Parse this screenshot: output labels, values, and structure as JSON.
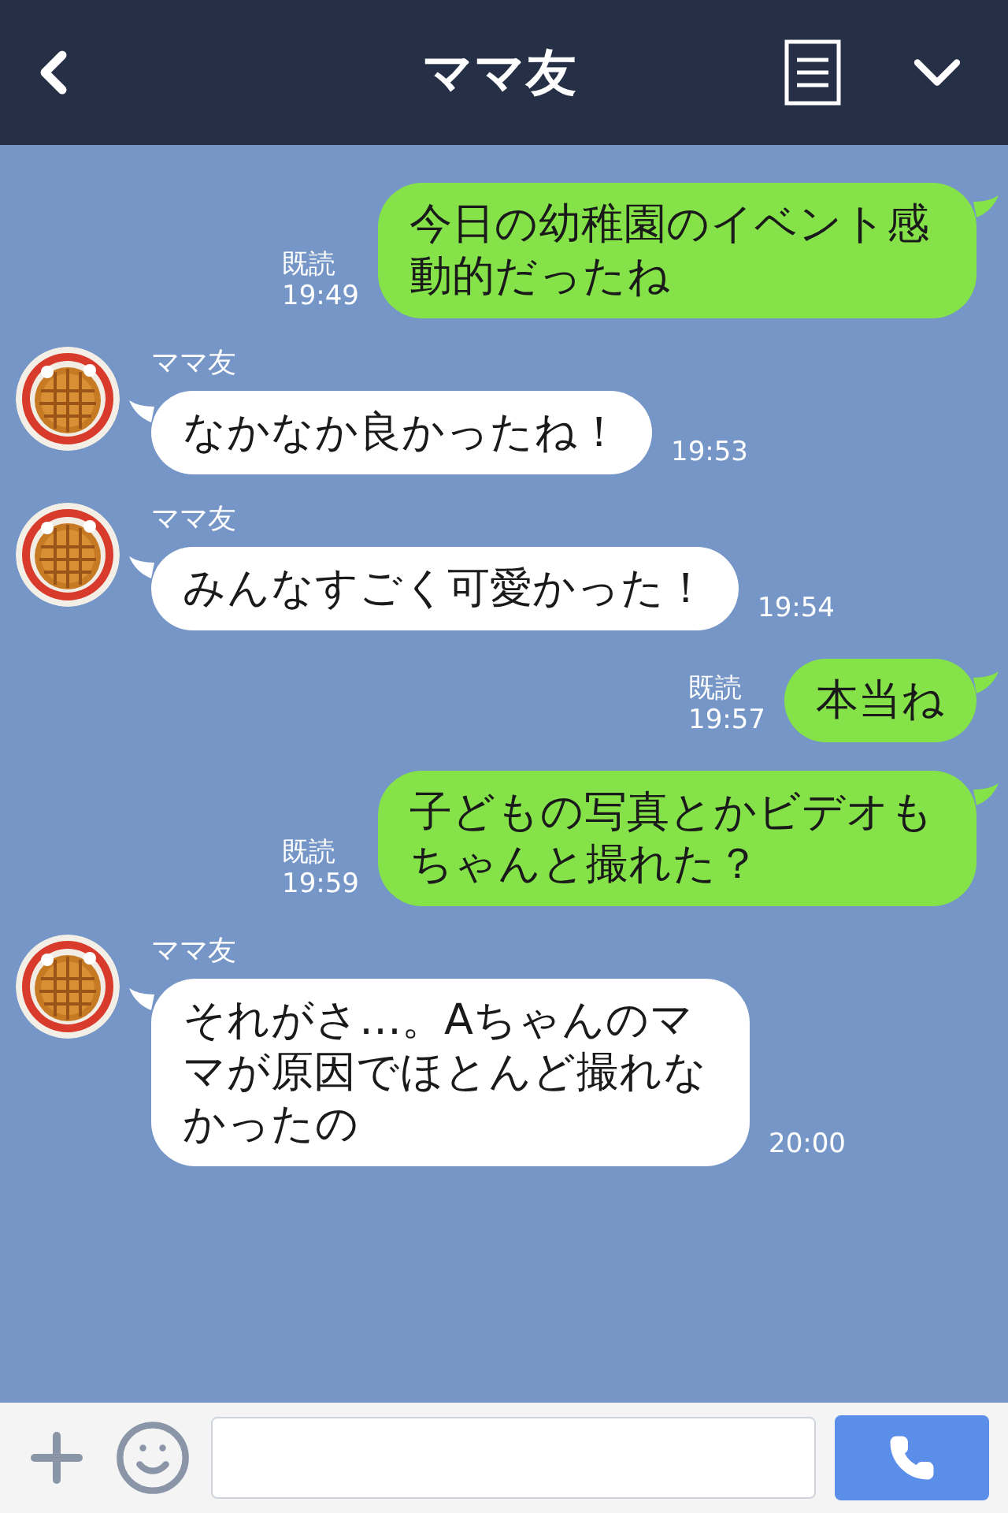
{
  "header": {
    "title": "ママ友"
  },
  "messages": [
    {
      "kind": "sent",
      "text": "今日の幼稚園のイベント感動的だったね",
      "read": "既読",
      "time": "19:49"
    },
    {
      "kind": "received",
      "name": "ママ友",
      "text": "なかなか良かったね！",
      "time": "19:53"
    },
    {
      "kind": "received",
      "name": "ママ友",
      "text": "みんなすごく可愛かった！",
      "time": "19:54"
    },
    {
      "kind": "sent",
      "text": "本当ね",
      "read": "既読",
      "time": "19:57"
    },
    {
      "kind": "sent",
      "text": "子どもの写真とかビデオもちゃんと撮れた？",
      "read": "既読",
      "time": "19:59"
    },
    {
      "kind": "received",
      "name": "ママ友",
      "text": "それがさ…。Aちゃんのママが原因でほとんど撮れなかったの",
      "time": "20:00"
    }
  ]
}
